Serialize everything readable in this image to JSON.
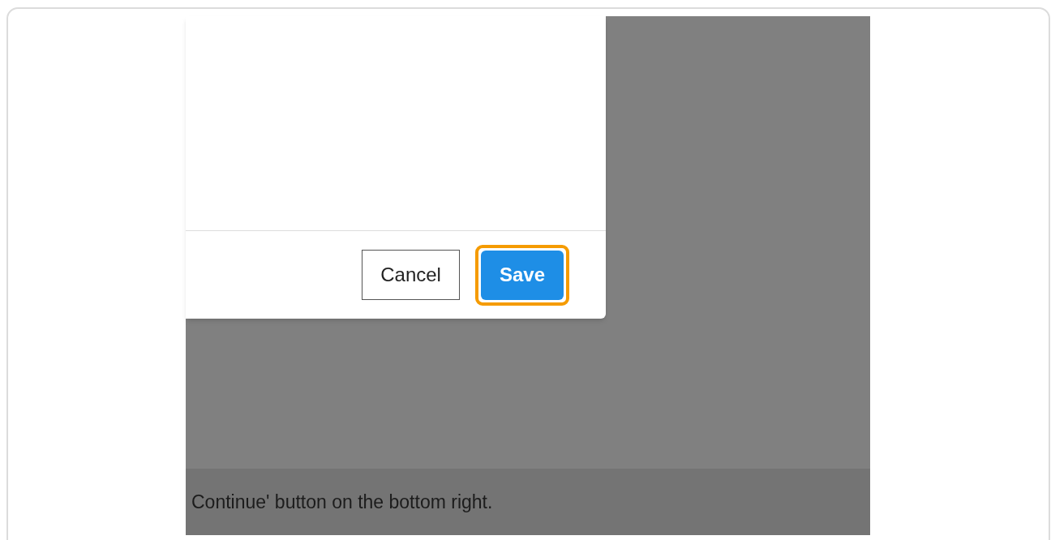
{
  "dialog": {
    "buttons": [
      {
        "label": "Cancel",
        "kind": "secondary",
        "highlighted": false
      },
      {
        "label": "Save",
        "kind": "primary",
        "highlighted": true
      }
    ]
  },
  "caption": "Continue' button on the bottom right."
}
